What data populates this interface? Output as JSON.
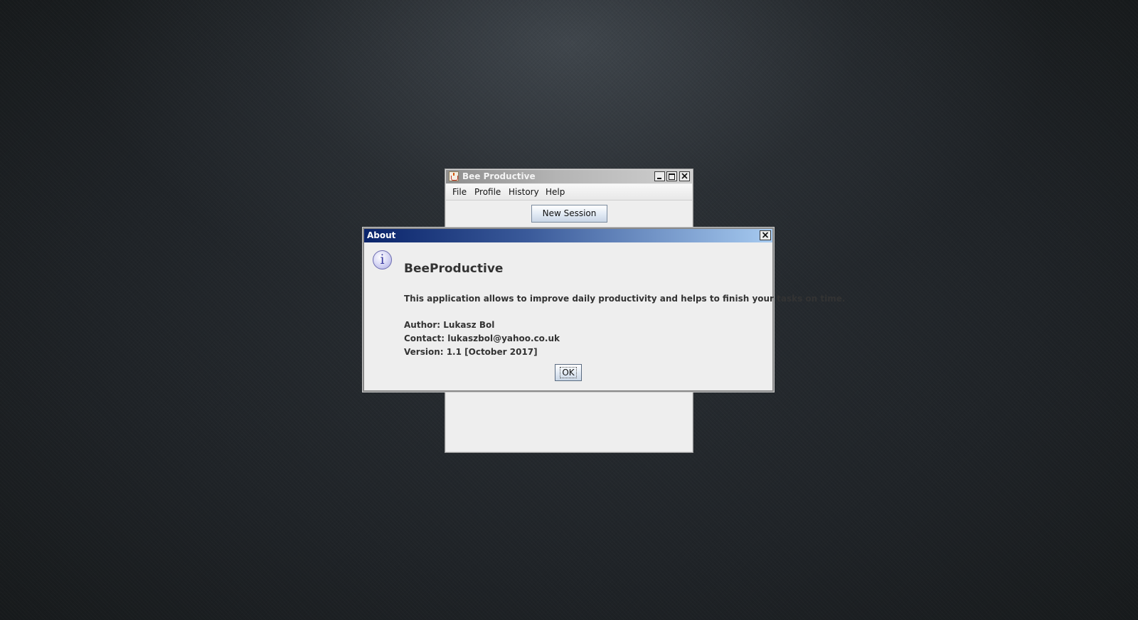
{
  "main_window": {
    "title": "Bee Productive",
    "menu": {
      "file": "File",
      "profile": "Profile",
      "history": "History",
      "help": "Help"
    },
    "new_session_label": "New Session"
  },
  "about_dialog": {
    "title": "About",
    "app_name": "BeeProductive",
    "description": "This application allows to improve daily productivity and helps to finish your tasks on time.",
    "author": "Author: Lukasz Bol",
    "contact": "Contact: lukaszbol@yahoo.co.uk",
    "version": "Version: 1.1  [October 2017]",
    "ok_label": "OK",
    "icon": "information-icon",
    "info_glyph": "i"
  },
  "colors": {
    "dialog_titlebar_start": "#0a246a",
    "dialog_titlebar_end": "#a6caf0",
    "window_background": "#eeeeee"
  }
}
